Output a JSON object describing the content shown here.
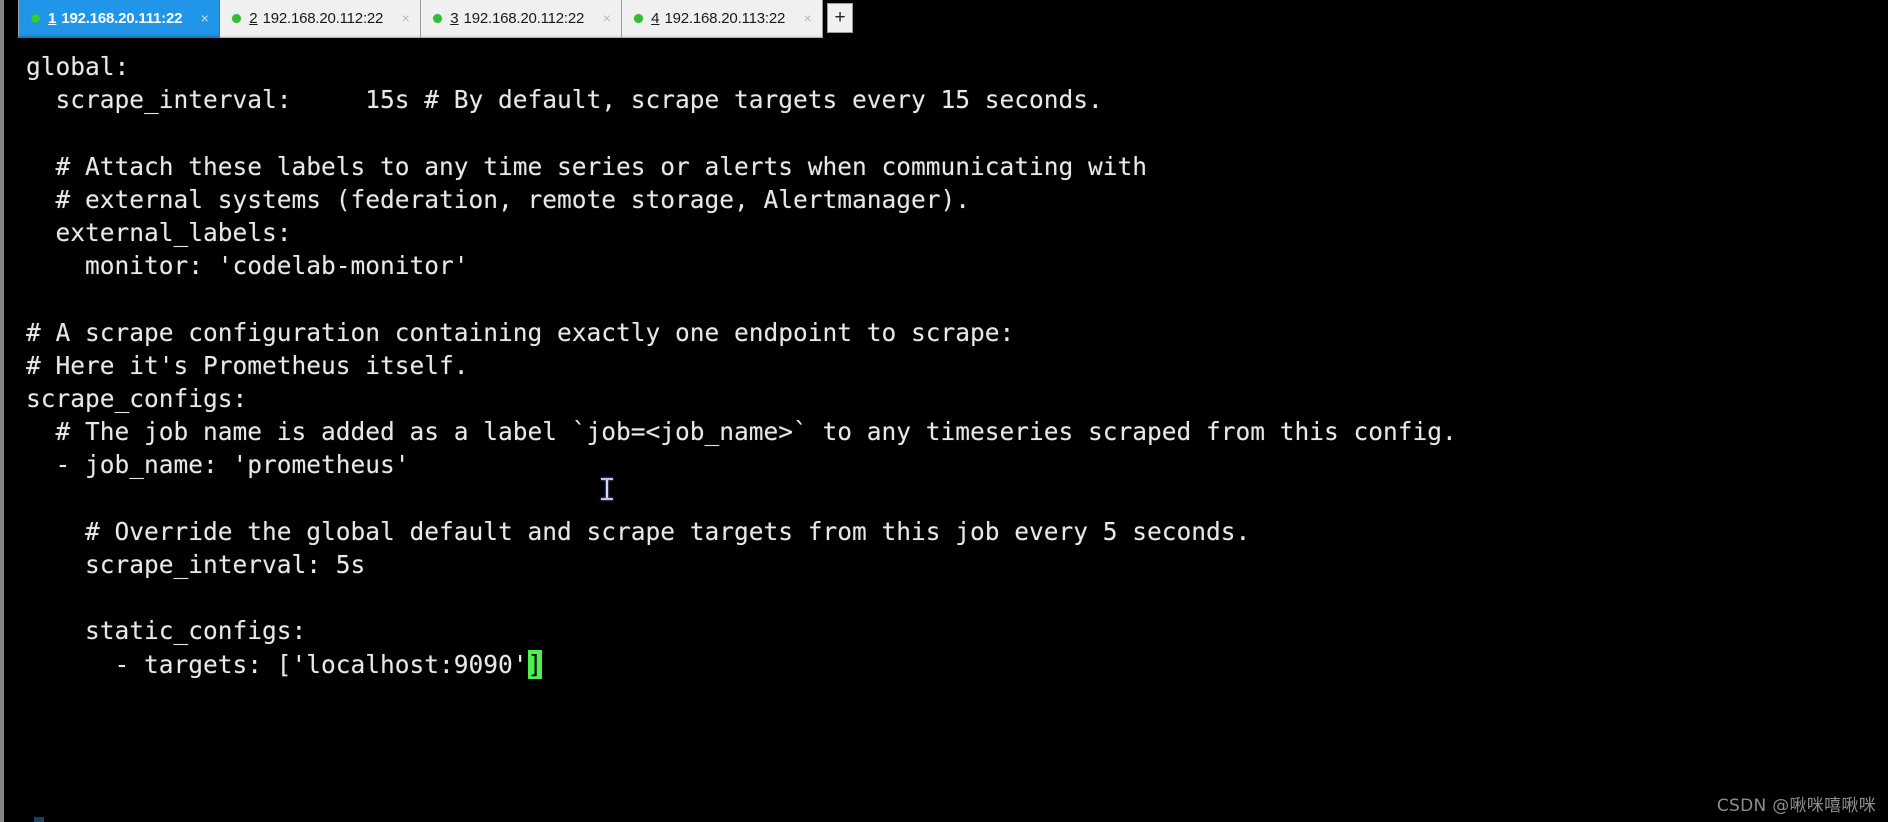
{
  "window": {
    "kind": "ssh-terminal-client",
    "colors": {
      "terminal_background": "#000000",
      "terminal_foreground": "#e8e8e8",
      "active_tab_background": "#2196e8",
      "inactive_tab_background": "#f0f0f0",
      "status_dot_connected": "#2fbf34",
      "block_cursor": "#4ef04e"
    }
  },
  "tabbar": {
    "new_tab_label": "+",
    "close_label": "×",
    "tabs": [
      {
        "number": "1",
        "label": "192.168.20.111:22",
        "active": true,
        "status": "connected"
      },
      {
        "number": "2",
        "label": "192.168.20.112:22",
        "active": false,
        "status": "connected"
      },
      {
        "number": "3",
        "label": "192.168.20.112:22",
        "active": false,
        "status": "connected"
      },
      {
        "number": "4",
        "label": "192.168.20.113:22",
        "active": false,
        "status": "connected"
      }
    ]
  },
  "terminal": {
    "lines": [
      "global:",
      "  scrape_interval:     15s # By default, scrape targets every 15 seconds.",
      "",
      "  # Attach these labels to any time series or alerts when communicating with",
      "  # external systems (federation, remote storage, Alertmanager).",
      "  external_labels:",
      "    monitor: 'codelab-monitor'",
      "",
      "# A scrape configuration containing exactly one endpoint to scrape:",
      "# Here it's Prometheus itself.",
      "scrape_configs:",
      "  # The job name is added as a label `job=<job_name>` to any timeseries scraped from this config.",
      "  - job_name: 'prometheus'",
      "",
      "    # Override the global default and scrape targets from this job every 5 seconds.",
      "    scrape_interval: 5s",
      "",
      "    static_configs:",
      "      - targets: ['localhost:9090'"
    ],
    "cursor_char": "]",
    "cursor_line_index": 18
  },
  "watermark": {
    "text": "CSDN @啾咪嘻啾咪"
  }
}
